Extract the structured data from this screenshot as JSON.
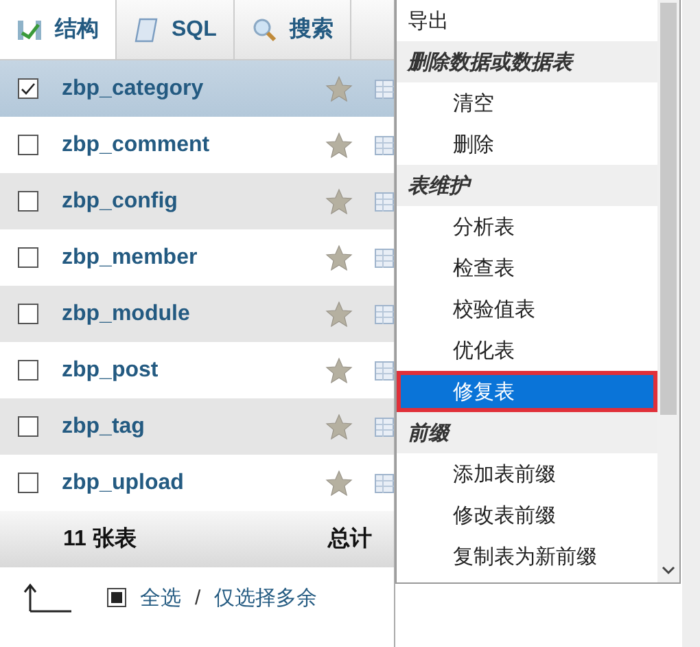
{
  "tabs": [
    {
      "label": "结构",
      "kind": "structure",
      "selected": true
    },
    {
      "label": "SQL",
      "kind": "sql",
      "selected": false
    },
    {
      "label": "搜索",
      "kind": "search",
      "selected": false
    }
  ],
  "tables": [
    {
      "name": "zbp_category",
      "checked": true,
      "selected": true
    },
    {
      "name": "zbp_comment",
      "checked": false,
      "selected": false
    },
    {
      "name": "zbp_config",
      "checked": false,
      "selected": false
    },
    {
      "name": "zbp_member",
      "checked": false,
      "selected": false
    },
    {
      "name": "zbp_module",
      "checked": false,
      "selected": false
    },
    {
      "name": "zbp_post",
      "checked": false,
      "selected": false
    },
    {
      "name": "zbp_tag",
      "checked": false,
      "selected": false
    },
    {
      "name": "zbp_upload",
      "checked": false,
      "selected": false
    }
  ],
  "footer": {
    "count": "11 张表",
    "total_label": "总计"
  },
  "bulk": {
    "checked": true,
    "select_all": "全选",
    "separator": "/",
    "select_overhead": "仅选择多余"
  },
  "menu": [
    {
      "kind": "item",
      "label": "导出",
      "selected": false
    },
    {
      "kind": "header",
      "label": "删除数据或数据表"
    },
    {
      "kind": "item",
      "label": "清空",
      "selected": false
    },
    {
      "kind": "item",
      "label": "删除",
      "selected": false
    },
    {
      "kind": "header",
      "label": "表维护"
    },
    {
      "kind": "item",
      "label": "分析表",
      "selected": false
    },
    {
      "kind": "item",
      "label": "检查表",
      "selected": false
    },
    {
      "kind": "item",
      "label": "校验值表",
      "selected": false
    },
    {
      "kind": "item",
      "label": "优化表",
      "selected": false
    },
    {
      "kind": "item",
      "label": "修复表",
      "selected": true
    },
    {
      "kind": "header",
      "label": "前缀"
    },
    {
      "kind": "item",
      "label": "添加表前缀",
      "selected": false
    },
    {
      "kind": "item",
      "label": "修改表前缀",
      "selected": false
    },
    {
      "kind": "item",
      "label": "复制表为新前缀",
      "selected": false
    }
  ]
}
